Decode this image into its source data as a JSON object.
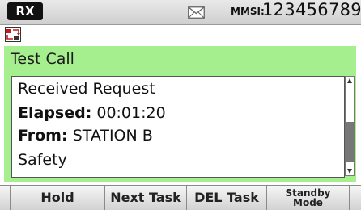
{
  "status": {
    "mode": "RX",
    "icon": "envelope-icon",
    "mmsi_label": "MMSI:",
    "mmsi_value": "123456789"
  },
  "task_icon": "task-list-icon",
  "title": "Test Call",
  "info": {
    "line1": "Received Request",
    "elapsed_label": "Elapsed:",
    "elapsed_value": " 00:01:20",
    "from_label": "From:",
    "from_value": " STATION B",
    "category": "Safety"
  },
  "softkeys": {
    "hold": "Hold",
    "next_task": "Next Task",
    "del_task": "DEL Task",
    "standby_mode": "Standby\nMode"
  },
  "colors": {
    "accent_green": "#a6ef8e",
    "badge_black": "#111111"
  }
}
